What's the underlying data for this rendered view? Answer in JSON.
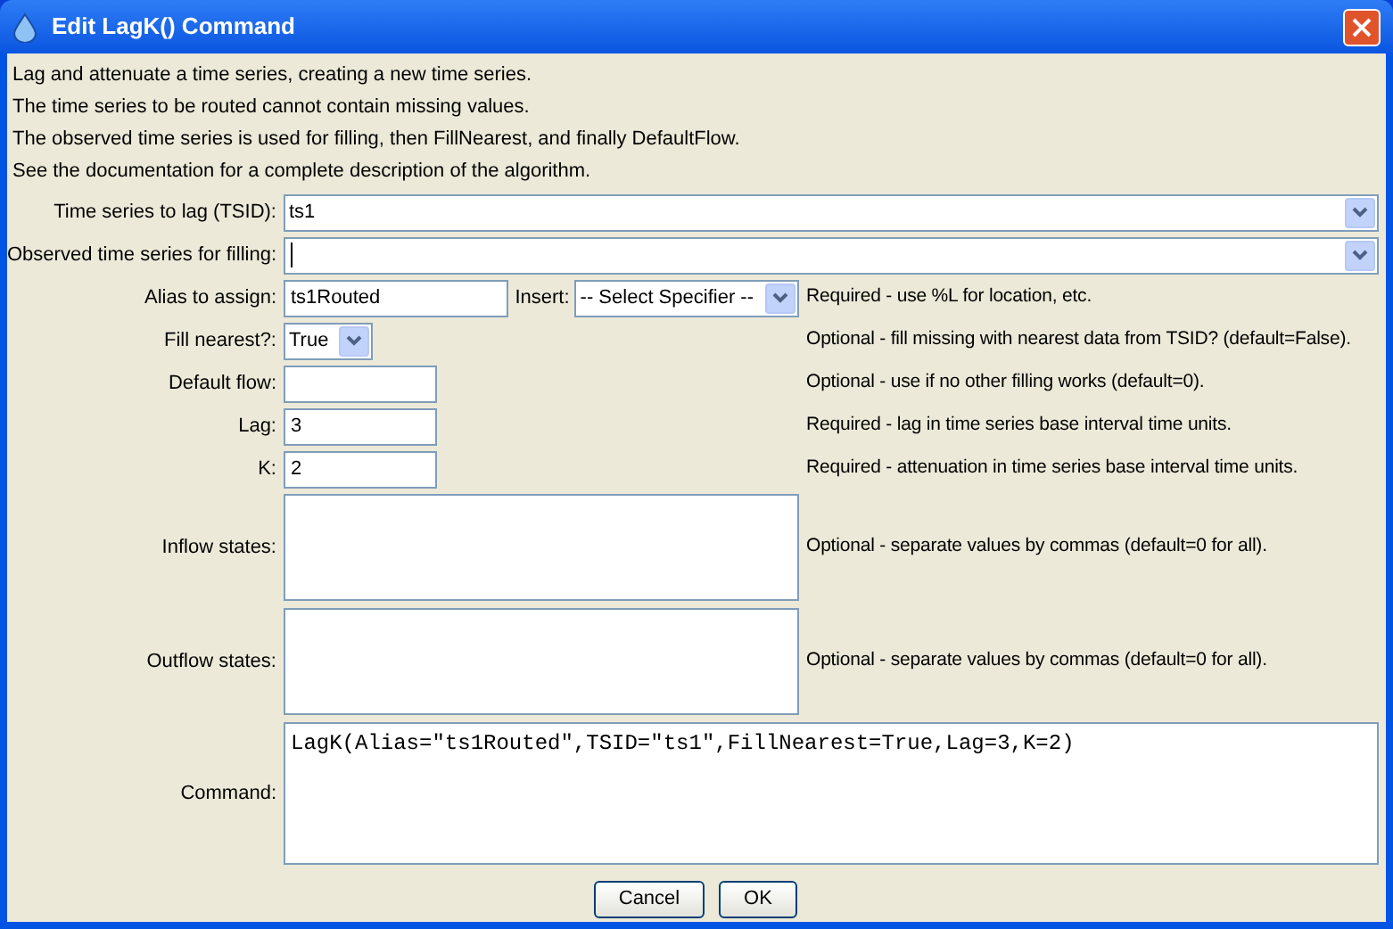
{
  "window": {
    "title": "Edit LagK() Command"
  },
  "description": [
    "Lag and attenuate a time series, creating a new time series.",
    "The time series to be routed cannot contain missing values.",
    "The observed time series is used for filling, then FillNearest, and finally DefaultFlow.",
    "See the documentation for a complete description of the algorithm."
  ],
  "fields": [
    {
      "kind": "wide-combo",
      "label": "Time series to lag (TSID):",
      "value": "ts1",
      "focused": false
    },
    {
      "kind": "wide-combo",
      "label": "Observed time series for filling:",
      "focused": true
    },
    {
      "kind": "alias",
      "label": "Alias to assign:",
      "value": "ts1Routed",
      "insert_label": "Insert:",
      "insert_value": "-- Select Specifier --",
      "note": "Required - use %L for location, etc."
    },
    {
      "kind": "small-combo",
      "label": "Fill nearest?:",
      "value": "True",
      "note": "Optional - fill missing with nearest data from TSID? (default=False)."
    },
    {
      "kind": "text",
      "label": "Default flow:",
      "note": "Optional - use if no other filling works (default=0)."
    },
    {
      "kind": "text",
      "label": "Lag:",
      "value": "3",
      "note": "Required - lag in time series base interval time units."
    },
    {
      "kind": "text",
      "label": "K:",
      "value": "2",
      "note": "Required - attenuation in time series base interval time units."
    },
    {
      "kind": "area",
      "label": "Inflow states:",
      "note": "Optional - separate values by commas (default=0 for all)."
    },
    {
      "kind": "area",
      "label": "Outflow states:",
      "note": "Optional - separate values by commas (default=0 for all)."
    },
    {
      "kind": "command",
      "label": "Command:",
      "value": "LagK(Alias=\"ts1Routed\",TSID=\"ts1\",FillNearest=True,Lag=3,K=2)"
    }
  ],
  "buttons": [
    "Cancel",
    "OK"
  ]
}
